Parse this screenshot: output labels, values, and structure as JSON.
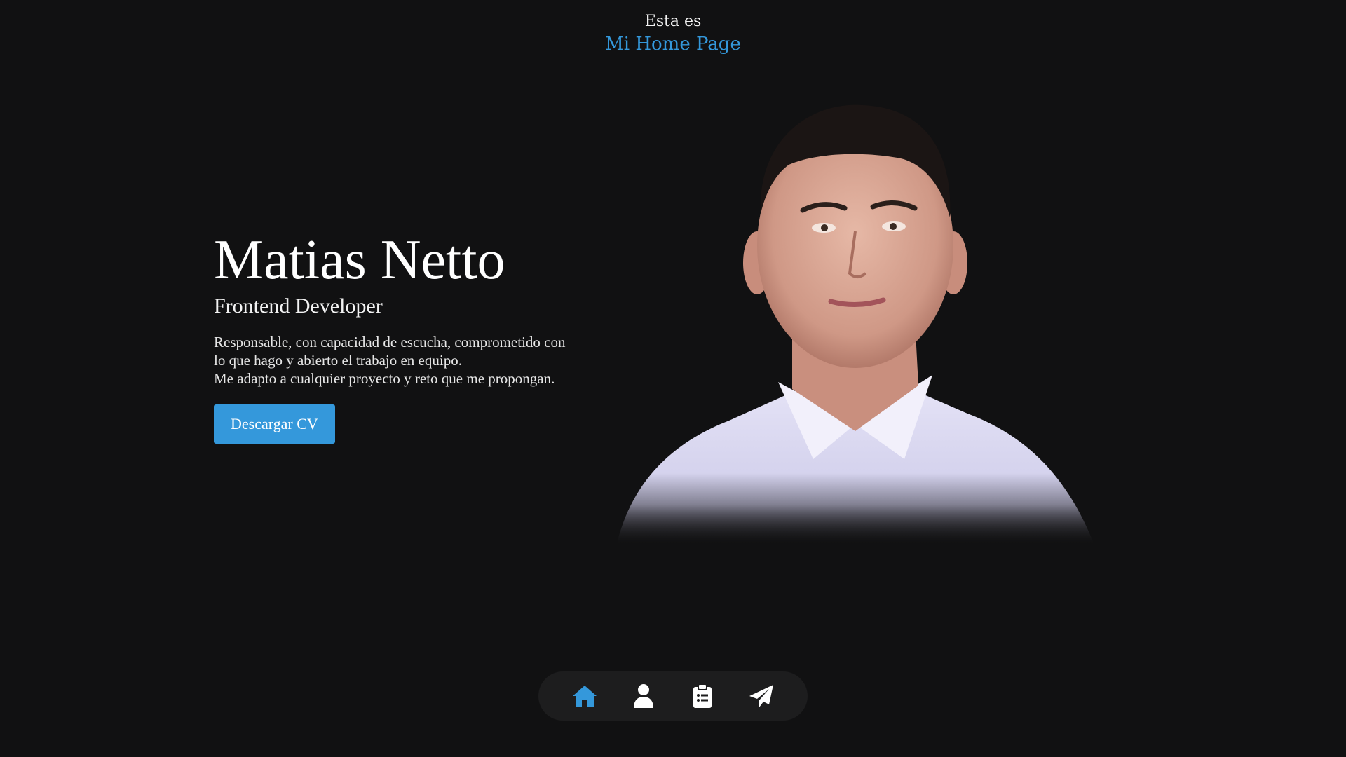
{
  "header": {
    "small_text": "Esta es",
    "site_title": "Mi Home Page"
  },
  "intro": {
    "name": "Matias Netto",
    "role": "Frontend Developer",
    "description_line1": "Responsable, con capacidad de escucha, comprometido con",
    "description_line2": "lo que hago y abierto el trabajo en equipo.",
    "description_line3": "Me adapto a cualquier proyecto y reto que me propongan.",
    "cv_button": "Descargar CV"
  },
  "nav": {
    "items": [
      {
        "icon": "home-icon",
        "active": true
      },
      {
        "icon": "user-icon",
        "active": false
      },
      {
        "icon": "clipboard-list-icon",
        "active": false
      },
      {
        "icon": "paper-plane-icon",
        "active": false
      }
    ]
  },
  "colors": {
    "background": "#111112",
    "accent": "#3498db",
    "nav_background": "#1d1d1e"
  }
}
